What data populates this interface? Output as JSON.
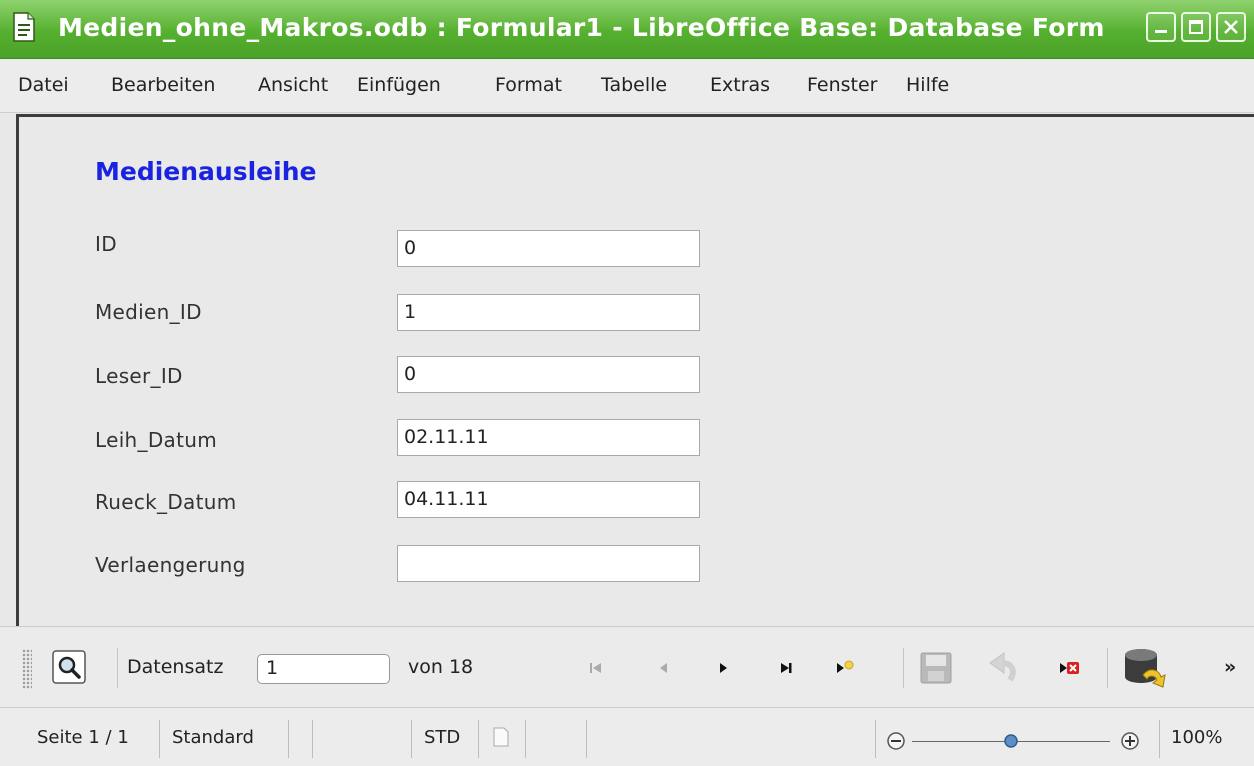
{
  "window": {
    "title": "Medien_ohne_Makros.odb : Formular1 - LibreOffice Base: Database Form",
    "title_bar_color": "#56b02f",
    "icons": [
      "document-icon",
      "minimize-icon",
      "maximize-icon",
      "close-icon"
    ]
  },
  "menu": {
    "items": [
      {
        "label": "Datei"
      },
      {
        "label": "Bearbeiten"
      },
      {
        "label": "Ansicht"
      },
      {
        "label": "Einfügen"
      },
      {
        "label": "Format"
      },
      {
        "label": "Tabelle"
      },
      {
        "label": "Extras"
      },
      {
        "label": "Fenster"
      },
      {
        "label": "Hilfe"
      }
    ]
  },
  "form": {
    "title": "Medienausleihe",
    "title_color": "#1a23e0",
    "fields": [
      {
        "label": "ID",
        "value": "0"
      },
      {
        "label": "Medien_ID",
        "value": "1"
      },
      {
        "label": "Leser_ID",
        "value": "0"
      },
      {
        "label": "Leih_Datum",
        "value": "02.11.11"
      },
      {
        "label": "Rueck_Datum",
        "value": "04.11.11"
      },
      {
        "label": "Verlaengerung",
        "value": ""
      }
    ]
  },
  "navigation": {
    "record_label": "Datensatz",
    "record_value": "1",
    "of_label": "von 18",
    "icons": [
      "find-record-icon",
      "first-record-icon",
      "previous-record-icon",
      "next-record-icon",
      "last-record-icon",
      "new-record-icon",
      "save-record-icon",
      "undo-icon",
      "delete-record-icon",
      "data-source-icon",
      "more-icon"
    ]
  },
  "statusbar": {
    "page": "Seite 1 / 1",
    "style": "Standard",
    "mode": "STD",
    "zoom": "100%"
  }
}
